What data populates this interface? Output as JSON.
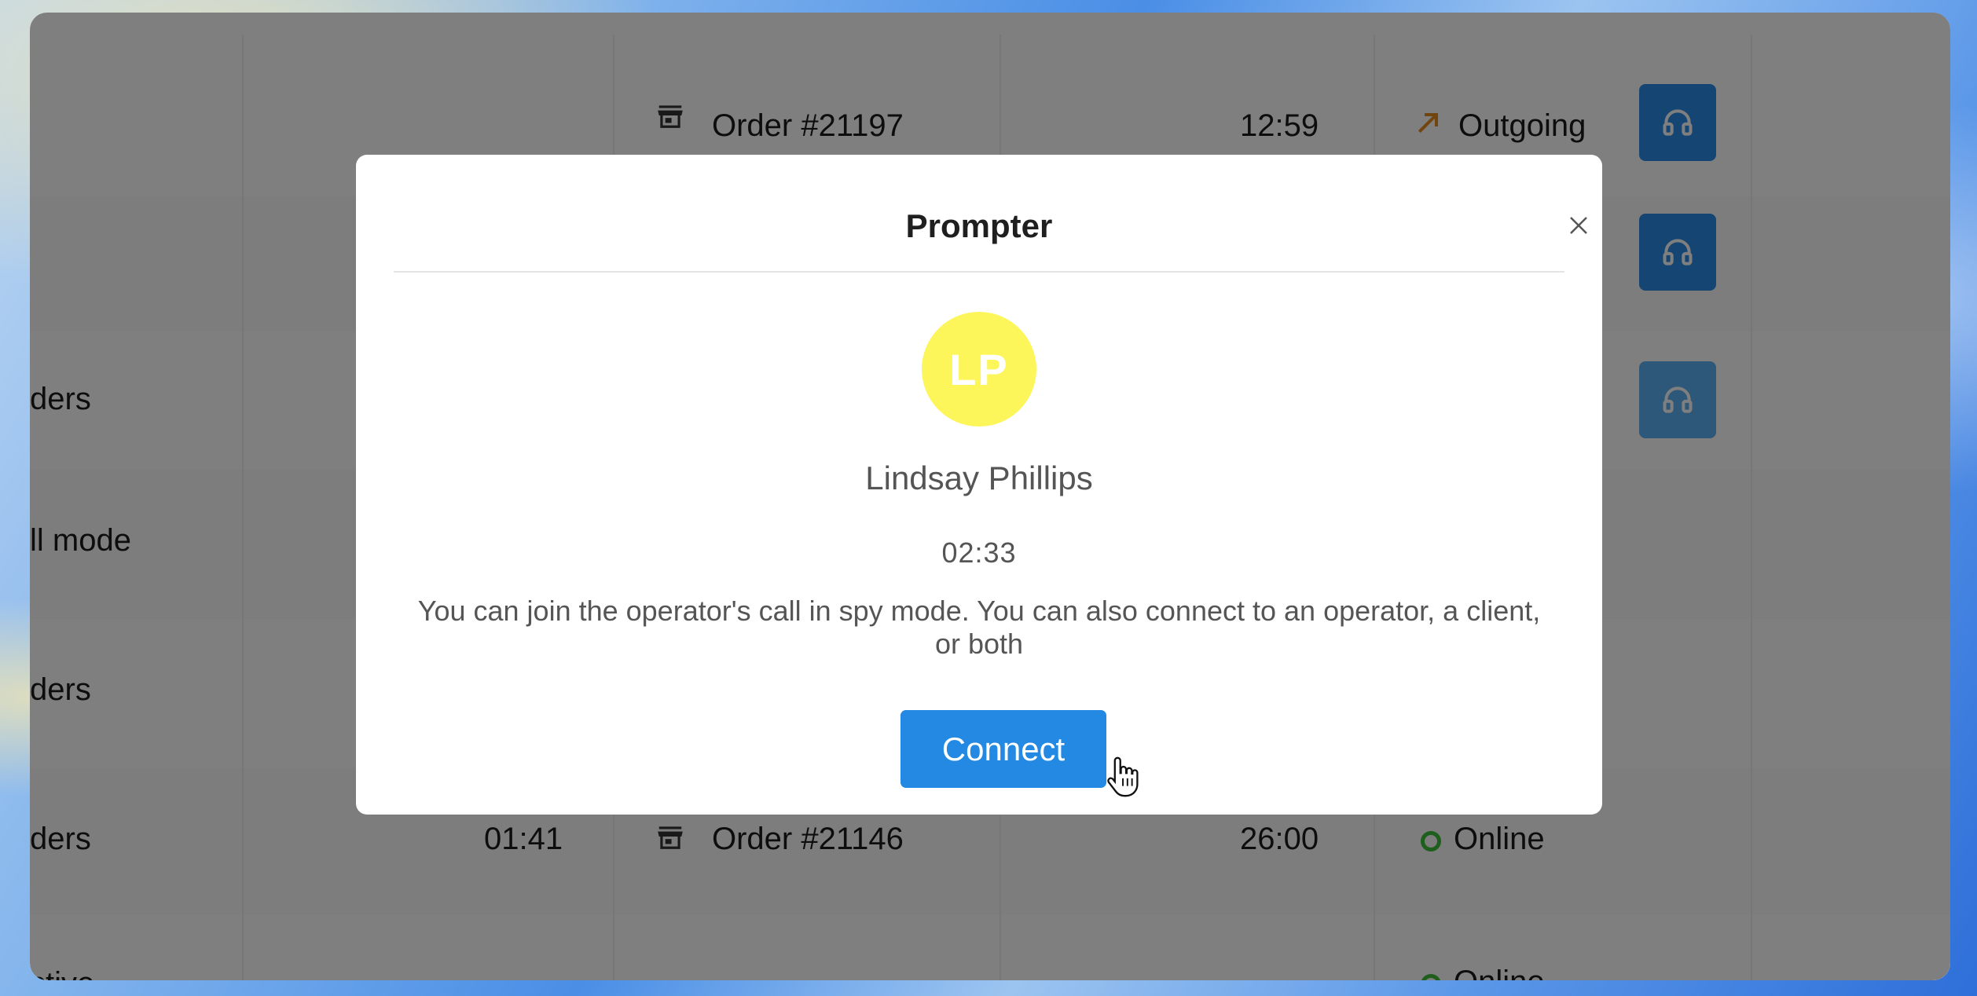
{
  "background_rows": [
    {
      "left_text": "",
      "order": "Order #21197",
      "duration": "12:59",
      "status": "Outgoing",
      "status_icon": "outgoing-arrow-icon",
      "has_headphones": true
    },
    {
      "left_text": "",
      "order": "",
      "duration": "",
      "status": "",
      "has_headphones": true
    },
    {
      "left_text": "ders",
      "order": "",
      "duration": "",
      "status": "",
      "has_headphones": true
    },
    {
      "left_text": "ll mode",
      "order": "",
      "duration": "",
      "status": "",
      "has_headphones": false
    },
    {
      "left_text": "ders",
      "order": "",
      "duration": "",
      "status": "",
      "has_headphones": false
    },
    {
      "left_text": "ders",
      "time": "01:41",
      "order": "Order #21146",
      "duration": "26:00",
      "status": "Online",
      "status_icon": "online-dot-icon",
      "has_headphones": false
    },
    {
      "left_text": "ctive",
      "order": "",
      "duration": "",
      "status": "Online",
      "status_icon": "online-dot-icon",
      "has_headphones": false
    }
  ],
  "modal": {
    "title": "Prompter",
    "avatar_initials": "LP",
    "person_name": "Lindsay Phillips",
    "timer": "02:33",
    "description": "You can join the operator's call in spy mode. You can also connect to an operator, a client, or both",
    "connect_label": "Connect"
  },
  "colors": {
    "accent": "#2389e2",
    "avatar_bg": "#fcf65a",
    "outgoing": "#e58a1f",
    "online": "#3dbf3a",
    "overlay": "rgba(0,0,0,0.5)"
  }
}
